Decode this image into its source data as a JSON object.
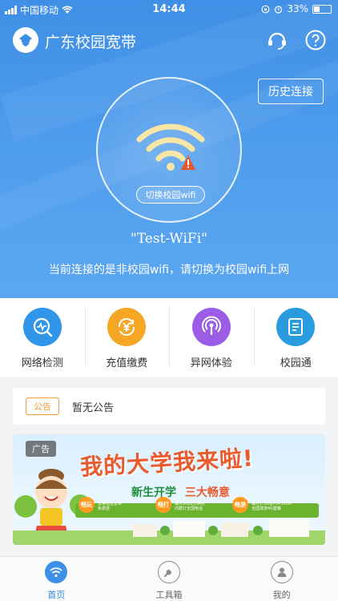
{
  "status_bar": {
    "carrier": "中国移动",
    "time": "14:44",
    "battery": "33%"
  },
  "header": {
    "title": "广东校园宽带"
  },
  "hero": {
    "history_label": "历史连接",
    "switch_label": "切换校园wifi",
    "ssid": "\"Test-WiFi\"",
    "message": "当前连接的是非校园wifi，请切换为校园wifi上网"
  },
  "tools": [
    {
      "label": "网络检测",
      "color": "#2f96ea",
      "icon": "network-check-icon"
    },
    {
      "label": "充值缴费",
      "color": "#f5a623",
      "icon": "yuan-recharge-icon"
    },
    {
      "label": "异网体验",
      "color": "#9b5de5",
      "icon": "broadcast-icon"
    },
    {
      "label": "校园通",
      "color": "#2b9be0",
      "icon": "document-icon"
    }
  ],
  "notice": {
    "tag": "公告",
    "text": "暂无公告"
  },
  "ad": {
    "tag": "广告",
    "headline": "我的大学我来啦!",
    "subtitle_a": "新生开学",
    "subtitle_b": "三大畅意",
    "chips": [
      {
        "badge": "畅玩",
        "text": "宽带宿舍宽带\n免费送"
      },
      {
        "badge": "畅打",
        "text": "每月1000分钟校\n内群打全国电话"
      },
      {
        "badge": "畅游",
        "text": "每月1.5G省内+500M\n全国漫游4G套餐"
      }
    ]
  },
  "tabbar": [
    {
      "label": "首页",
      "active": true,
      "icon": "wifi-home-icon"
    },
    {
      "label": "工具箱",
      "active": false,
      "icon": "wrench-icon"
    },
    {
      "label": "我的",
      "active": false,
      "icon": "user-icon"
    }
  ],
  "colors": {
    "primary": "#3f8fe6",
    "accent_orange": "#f39a3c",
    "active_tab": "#2f86e8"
  }
}
